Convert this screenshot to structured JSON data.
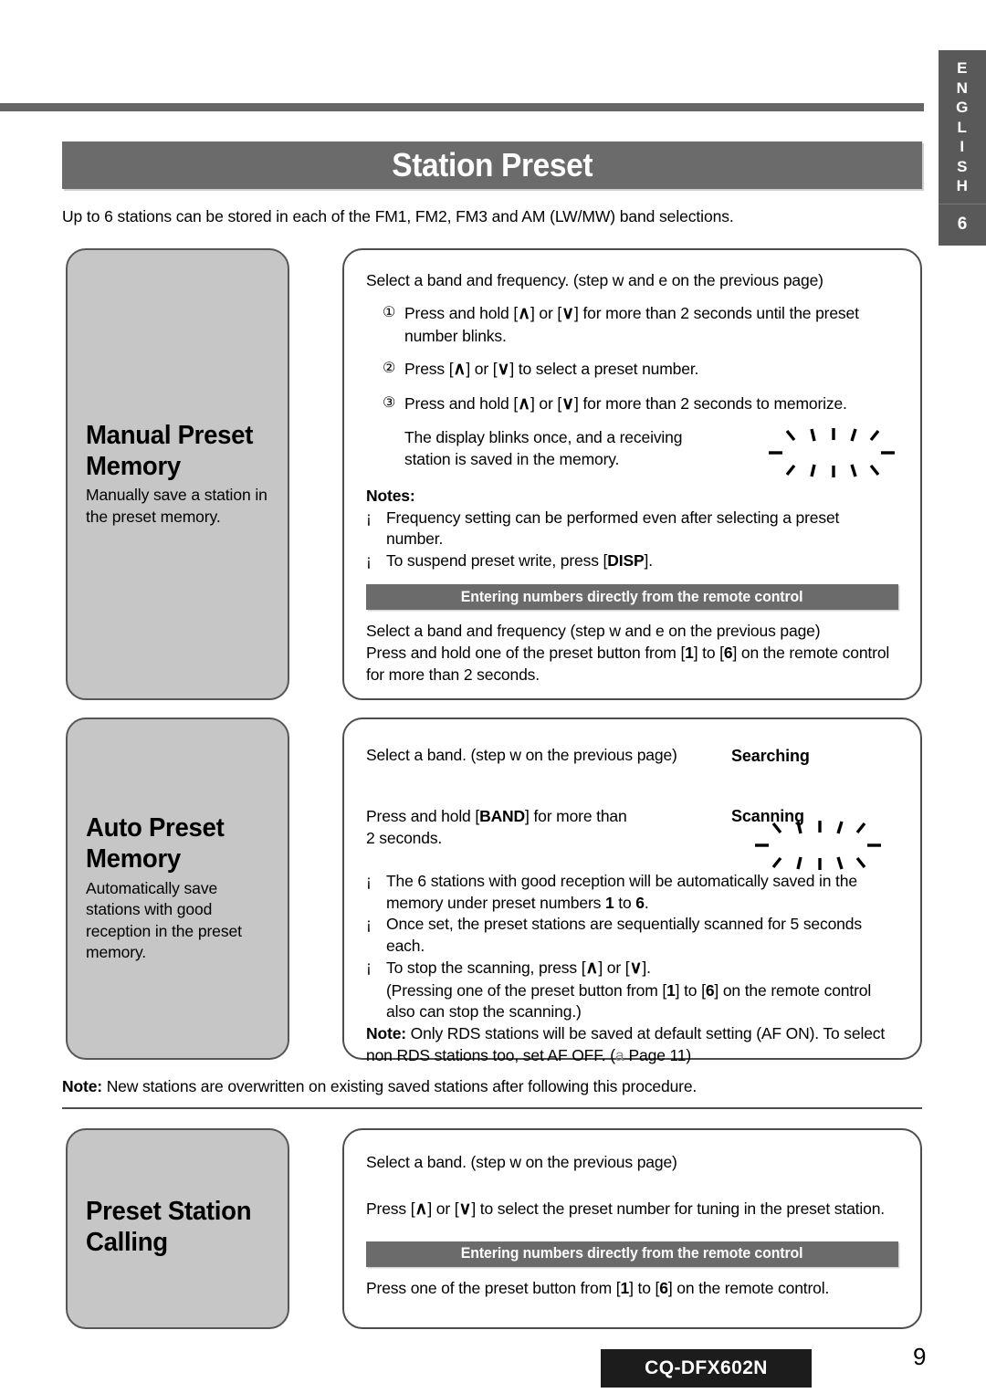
{
  "page": {
    "title": "Station Preset",
    "intro": "Up to 6 stations can be stored in each of the FM1, FM2, FM3 and AM (LW/MW) band selections.",
    "page_number": "9",
    "model": "CQ-DFX602N",
    "colors": {
      "banner_gray": "#6b6b6b",
      "card_gray": "#c6c6c6",
      "card_border": "#4d4d4d",
      "footer_dark": "#1c1c1c"
    }
  },
  "side_tab": {
    "language_letters": [
      "E",
      "N",
      "G",
      "L",
      "I",
      "S",
      "H"
    ],
    "chapter": "6"
  },
  "sections": [
    {
      "heading": "Manual Preset\nMemory",
      "heading_line1": "Manual Preset",
      "heading_line2": "Memory",
      "description": "Manually save a station in the preset memory.",
      "intro_line": "Select a band and frequency. (step w  and e   on the previous page)",
      "steps": [
        {
          "num": "①",
          "text_parts": [
            "Press and hold [",
            "∧",
            "] or [",
            "∨",
            "] for more than 2 seconds until the preset number blinks."
          ]
        },
        {
          "num": "②",
          "text_parts": [
            "Press [",
            "∧",
            "] or [",
            "∨",
            "] to select a preset number."
          ]
        },
        {
          "num": "③",
          "text_parts": [
            "Press and hold [",
            "∧",
            "] or [",
            "∨",
            "] for more than 2 seconds to memorize."
          ]
        }
      ],
      "result_text_line1": "The display blinks once, and a receiving",
      "result_text_line2": "station is saved in the memory.",
      "notes_label": "Notes:",
      "notes": [
        "Frequency setting can be performed even after selecting a preset number.",
        "To suspend preset write, press [DISP]."
      ],
      "notes_bold": [
        "",
        "DISP"
      ],
      "sub_banner": "Entering numbers directly from the remote control",
      "remote_lines": [
        "Select a band and frequency (step w  and e   on the previous page)",
        "Press and hold one of the preset button from [1] to [6] on the remote control for more than 2 seconds."
      ]
    },
    {
      "heading_line1": "Auto Preset",
      "heading_line2": "Memory",
      "description": "Automatically save stations with good reception in the preset memory.",
      "intro_line": "Select a band. (step w  on the previous page)",
      "action_line1": "Press and hold [BAND] for more than",
      "action_line2": "2 seconds.",
      "action_key": "BAND",
      "status_searching": "Searching",
      "status_scanning": "Scanning",
      "bullets": [
        "The 6 stations with good reception will be automatically saved in the memory under preset numbers 1 to 6.",
        "Once set, the preset stations are sequentially scanned for 5 seconds each.",
        "To stop the scanning, press [∧] or [∨].\n(Pressing one of the preset button from [1] to [6] on the remote control also can stop the scanning.)"
      ],
      "note_label": "Note:",
      "note_text": "Only RDS stations will be saved at default setting (AF ON). To select non RDS stations too, set AF OFF. (a   Page 11)",
      "note_page_ref": "Page 11"
    },
    {
      "heading_line1": "Preset Station",
      "heading_line2": "Calling",
      "intro_line": "Select a band. (step w  on the previous page)",
      "action_line": "Press [∧] or [∨] to select the preset number for tuning in the preset station.",
      "sub_banner": "Entering numbers directly from the remote control",
      "remote_line": "Press one of the preset button from [1] to [6] on the remote control."
    }
  ],
  "middle_note": {
    "label": "Note:",
    "text": "New stations are overwritten on existing saved stations after following this procedure."
  }
}
